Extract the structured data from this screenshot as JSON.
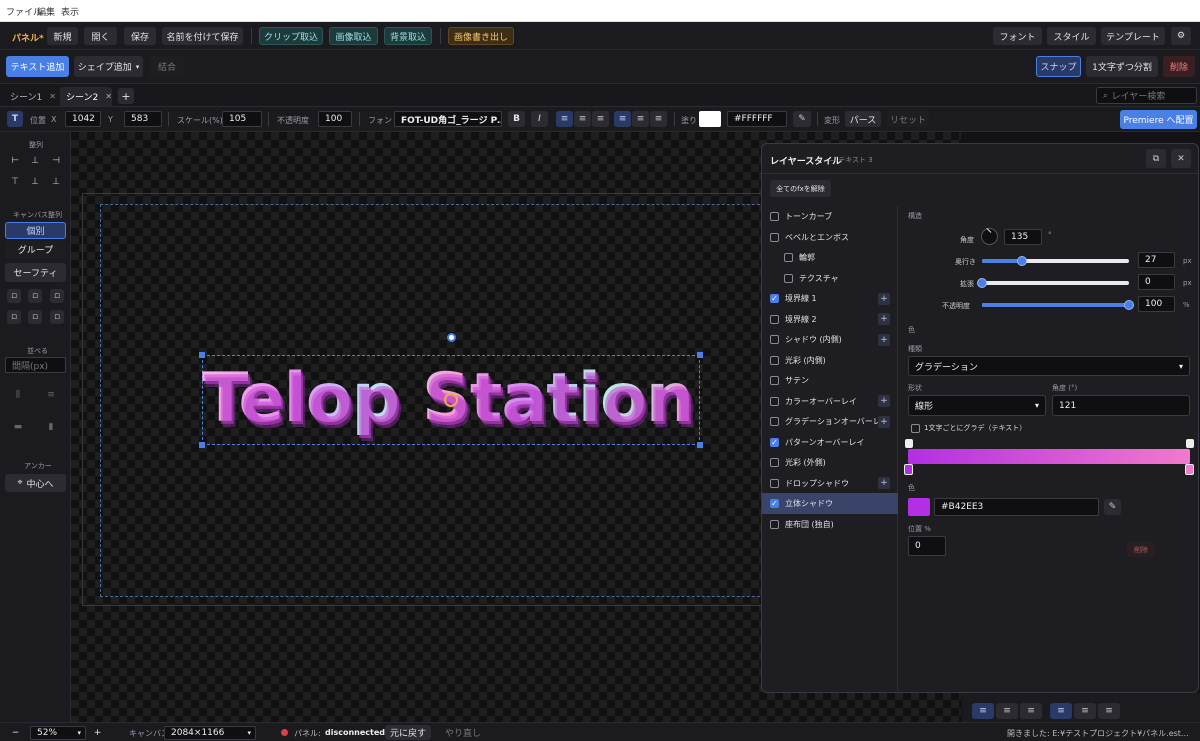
{
  "menu": {
    "file": "ファイル",
    "edit": "編集",
    "view": "表示"
  },
  "toolbar": {
    "panel": "パネル*",
    "new": "新規",
    "open": "開く",
    "save": "保存",
    "save_as": "名前を付けて保存",
    "clip": "クリップ取込",
    "image": "画像取込",
    "bg": "背景取込",
    "export": "画像書き出し",
    "font": "フォント",
    "style": "スタイル",
    "template": "テンプレート",
    "gear": "⚙"
  },
  "toolbar2": {
    "add_text": "テキスト追加",
    "add_shape": "シェイプ追加",
    "shape_arrow": "▾",
    "combine": "結合",
    "snap": "スナップ",
    "split": "1文字ずつ分割",
    "delete": "削除"
  },
  "tabs": [
    {
      "label": "シーン1"
    },
    {
      "label": "シーン2"
    }
  ],
  "tab_close": "✕",
  "tab_add": "+",
  "layer_search": {
    "placeholder": "レイヤー検索"
  },
  "props": {
    "type_icon": "T",
    "pos_label": "位置",
    "x_label": "X",
    "x": "1042",
    "y_label": "Y",
    "y": "583",
    "scale_label": "スケール(%)",
    "scale": "105",
    "opacity_label": "不透明度",
    "opacity": "100",
    "font_label": "フォント",
    "font": "FOT-UD角ゴ_ラージ P…",
    "bold": "B",
    "italic": "I",
    "fill_label": "塗り",
    "fill_hex": "#FFFFFF",
    "transform_label": "変形",
    "perspective": "パース",
    "reset": "リセット",
    "premiere": "Premiere へ配置"
  },
  "sidebar": {
    "align_title": "整列",
    "canvas_align": "キャンバス整列",
    "individual": "個別",
    "group": "グループ",
    "safety": "セーフティ",
    "arrange": "並べる",
    "spacing_placeholder": "間隔(px)",
    "anchor": "アンカー",
    "center": "中心へ"
  },
  "canvas": {
    "text": "Telop Station"
  },
  "panel": {
    "title": "レイヤースタイル",
    "subtitle": "— テキスト 3",
    "clear_fx": "全てのfxを解除",
    "fx": [
      {
        "label": "トーンカーブ",
        "checked": false,
        "indent": false,
        "plus": false
      },
      {
        "label": "ベベルとエンボス",
        "checked": false,
        "indent": false,
        "plus": false
      },
      {
        "label": "輪郭",
        "checked": false,
        "indent": true,
        "plus": false
      },
      {
        "label": "テクスチャ",
        "checked": false,
        "indent": true,
        "plus": false
      },
      {
        "label": "境界線 1",
        "checked": true,
        "indent": false,
        "plus": true
      },
      {
        "label": "境界線 2",
        "checked": false,
        "indent": false,
        "plus": true
      },
      {
        "label": "シャドウ (内側)",
        "checked": false,
        "indent": false,
        "plus": true
      },
      {
        "label": "光彩 (内側)",
        "checked": false,
        "indent": false,
        "plus": false
      },
      {
        "label": "サテン",
        "checked": false,
        "indent": false,
        "plus": false
      },
      {
        "label": "カラーオーバーレイ",
        "checked": false,
        "indent": false,
        "plus": true
      },
      {
        "label": "グラデーションオーバーレイ",
        "checked": false,
        "indent": false,
        "plus": true
      },
      {
        "label": "パターンオーバーレイ",
        "checked": true,
        "indent": false,
        "plus": false
      },
      {
        "label": "光彩 (外側)",
        "checked": false,
        "indent": false,
        "plus": false
      },
      {
        "label": "ドロップシャドウ",
        "checked": false,
        "indent": false,
        "plus": true
      },
      {
        "label": "立体シャドウ",
        "checked": true,
        "indent": false,
        "plus": false,
        "selected": true
      },
      {
        "label": "座布団 (独自)",
        "checked": false,
        "indent": false,
        "plus": false
      }
    ],
    "structure": "構造",
    "angle_label": "角度",
    "angle": "135",
    "deg": "°",
    "depth_label": "奥行き",
    "depth": "27",
    "px1": "px",
    "spread_label": "拡張",
    "spread": "0",
    "px2": "px",
    "opacity_label": "不透明度",
    "opacity": "100",
    "pct": "%",
    "depth_level": 0.27,
    "spread_level": 0.0,
    "opacity_level": 1.0,
    "color_section": "色",
    "kind_label": "種類",
    "kind": "グラデーション",
    "shape_label": "形状",
    "shape": "線形",
    "grad_angle_label": "角度 (°)",
    "grad_angle": "121",
    "per_char": "1文字ごとにグラデ（テキスト）",
    "stop_color_label": "色",
    "stop_hex": "#B42EE3",
    "pos_label": "位置 %",
    "pos": "0",
    "delete_stop": "削除",
    "colors": {
      "stop": "#B42EE3",
      "grad_end": "#F27ACB"
    }
  },
  "status": {
    "zoom_minus": "−",
    "zoom": "52%",
    "zoom_plus": "+",
    "canvas_label": "キャンバス",
    "canvas_size": "2084×1166",
    "panel_label": "パネル:",
    "panel_status": "disconnected",
    "undo": "元に戻す",
    "redo": "やり直し",
    "path": "開きました: E:¥テストプロジェクト¥パネル.est…"
  }
}
